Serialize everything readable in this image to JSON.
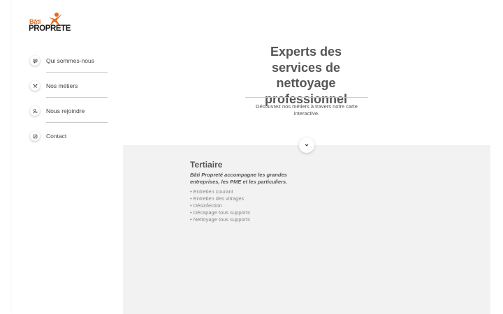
{
  "brand": {
    "name_line1": "Bâti",
    "name_line2": "PROPRETE",
    "accent": "#e56b1f"
  },
  "sidebar": {
    "items": [
      {
        "label": "Qui sommes-nous",
        "icon": "chat-bubble-icon"
      },
      {
        "label": "Nos métiers",
        "icon": "tools-icon"
      },
      {
        "label": "Nous rejoindre",
        "icon": "user-add-icon"
      },
      {
        "label": "Contact",
        "icon": "edit-note-icon"
      }
    ]
  },
  "hero": {
    "title": "Experts des services de nettoyage professionnel",
    "subtitle": "Découvrez nos métiers à travers notre carte interactive."
  },
  "section": {
    "title": "Tertiaire",
    "description": "Bâti Propreté accompagne les grandes entreprises, les PME et les particuliers.",
    "items": [
      "• Entretien courant",
      "• Entretien des vitrages",
      "• Désinfection",
      "• Décapage tous supports",
      "• Nettoyage tous supports"
    ]
  }
}
